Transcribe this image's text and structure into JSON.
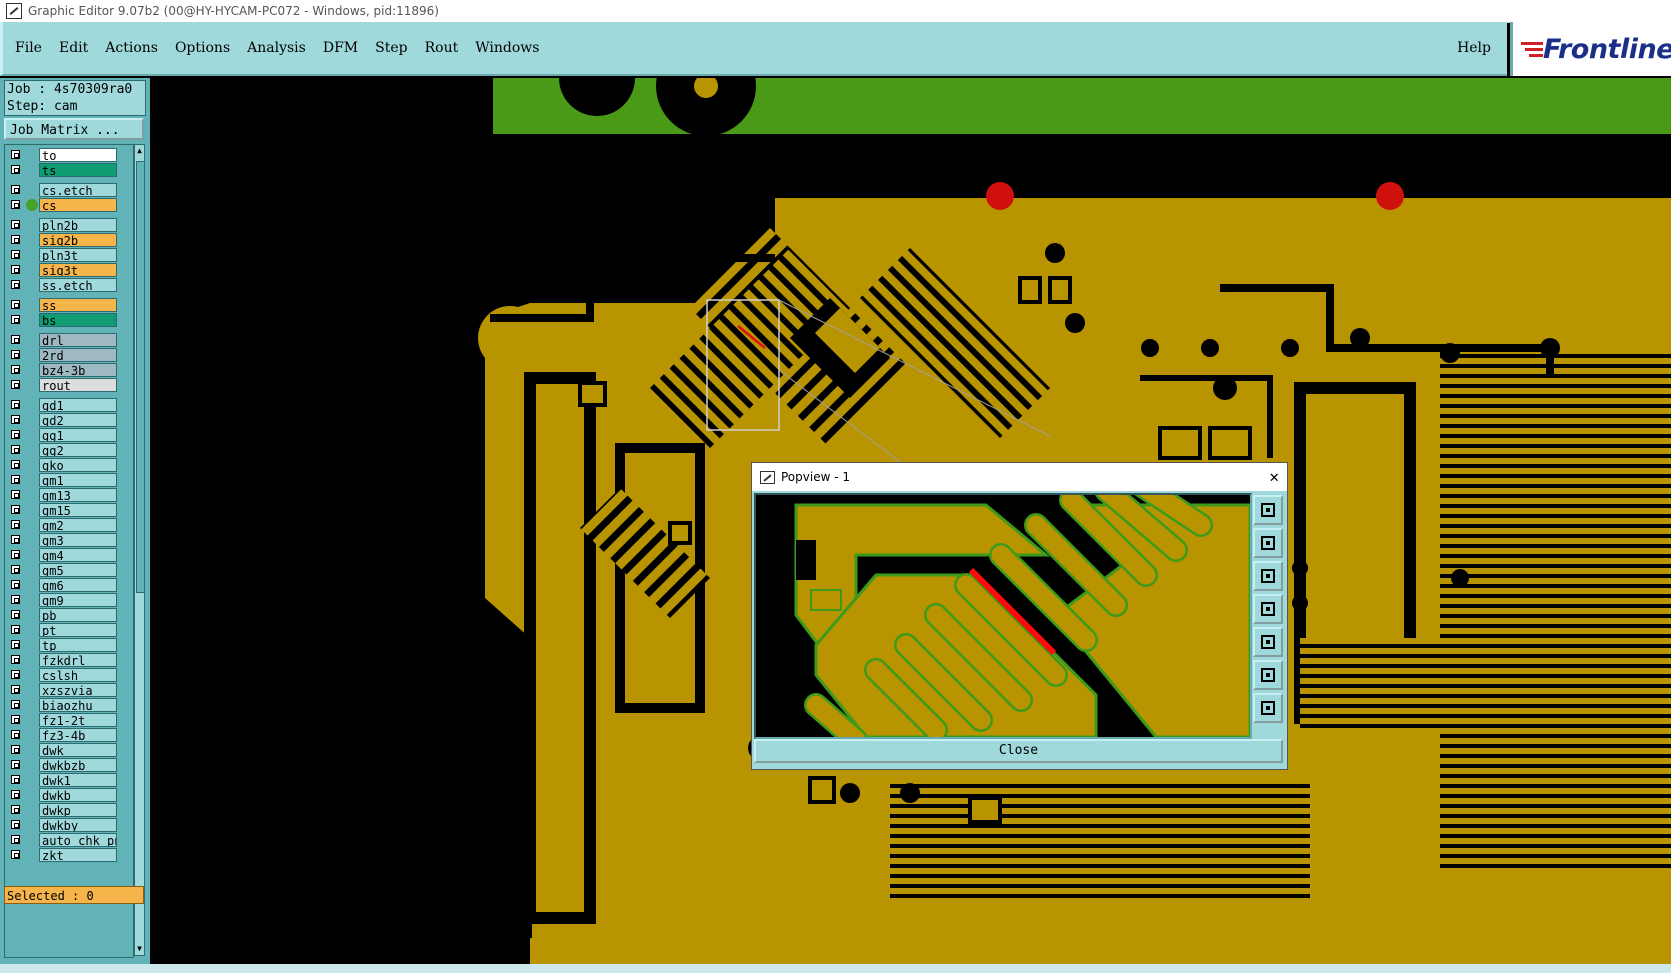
{
  "window": {
    "title": "Graphic Editor 9.07b2 (00@HY-HYCAM-PC072 - Windows, pid:11896)"
  },
  "menu": [
    "File",
    "Edit",
    "Actions",
    "Options",
    "Analysis",
    "DFM",
    "Step",
    "Rout",
    "Windows"
  ],
  "help_label": "Help",
  "logo_text": "Frontline",
  "job": {
    "job_line": "Job : 4s70309ra0",
    "step_line": "Step: cam",
    "job_matrix_label": "Job Matrix ..."
  },
  "layers": [
    {
      "name": "to",
      "color": "#ffffff",
      "active": false
    },
    {
      "name": "ts",
      "color": "#0f9c72",
      "active": false
    },
    {
      "name": "cs.etch",
      "color": "#9fd9dc",
      "active": false
    },
    {
      "name": "cs",
      "color": "#f5b54a",
      "active": true
    },
    {
      "name": "pln2b",
      "color": "#9fd9dc",
      "active": false
    },
    {
      "name": "sig2b",
      "color": "#f5b54a",
      "active": false
    },
    {
      "name": "pln3t",
      "color": "#9fd9dc",
      "active": false
    },
    {
      "name": "sig3t",
      "color": "#f5b54a",
      "active": false
    },
    {
      "name": "ss.etch",
      "color": "#9fd9dc",
      "active": false
    },
    {
      "name": "ss",
      "color": "#f5b54a",
      "active": false
    },
    {
      "name": "bs",
      "color": "#0f9c72",
      "active": false
    },
    {
      "name": "drl",
      "color": "#9fb9c2",
      "active": false
    },
    {
      "name": "2rd",
      "color": "#9fb9c2",
      "active": false
    },
    {
      "name": "bz4-3b",
      "color": "#9fb9c2",
      "active": false
    },
    {
      "name": "rout",
      "color": "#dddddd",
      "active": false
    },
    {
      "name": "gd1",
      "color": "#9fd9dc",
      "active": false
    },
    {
      "name": "gd2",
      "color": "#9fd9dc",
      "active": false
    },
    {
      "name": "gg1",
      "color": "#9fd9dc",
      "active": false
    },
    {
      "name": "gg2",
      "color": "#9fd9dc",
      "active": false
    },
    {
      "name": "gko",
      "color": "#9fd9dc",
      "active": false
    },
    {
      "name": "gm1",
      "color": "#9fd9dc",
      "active": false
    },
    {
      "name": "gm13",
      "color": "#9fd9dc",
      "active": false
    },
    {
      "name": "gm15",
      "color": "#9fd9dc",
      "active": false
    },
    {
      "name": "gm2",
      "color": "#9fd9dc",
      "active": false
    },
    {
      "name": "gm3",
      "color": "#9fd9dc",
      "active": false
    },
    {
      "name": "gm4",
      "color": "#9fd9dc",
      "active": false
    },
    {
      "name": "gm5",
      "color": "#9fd9dc",
      "active": false
    },
    {
      "name": "gm6",
      "color": "#9fd9dc",
      "active": false
    },
    {
      "name": "gm9",
      "color": "#9fd9dc",
      "active": false
    },
    {
      "name": "pb",
      "color": "#9fd9dc",
      "active": false
    },
    {
      "name": "pt",
      "color": "#9fd9dc",
      "active": false
    },
    {
      "name": "tp",
      "color": "#9fd9dc",
      "active": false
    },
    {
      "name": "fzkdrl",
      "color": "#9fd9dc",
      "active": false
    },
    {
      "name": "cslsh",
      "color": "#9fd9dc",
      "active": false
    },
    {
      "name": "xzszvia",
      "color": "#9fd9dc",
      "active": false
    },
    {
      "name": "biaozhu",
      "color": "#9fd9dc",
      "active": false
    },
    {
      "name": "fz1-2t",
      "color": "#9fd9dc",
      "active": false
    },
    {
      "name": "fz3-4b",
      "color": "#9fd9dc",
      "active": false
    },
    {
      "name": "dwk",
      "color": "#9fd9dc",
      "active": false
    },
    {
      "name": "dwkbzb",
      "color": "#9fd9dc",
      "active": false
    },
    {
      "name": "dwk1",
      "color": "#9fd9dc",
      "active": false
    },
    {
      "name": "dwkb",
      "color": "#9fd9dc",
      "active": false
    },
    {
      "name": "dwkp",
      "color": "#9fd9dc",
      "active": false
    },
    {
      "name": "dwkby",
      "color": "#9fd9dc",
      "active": false
    },
    {
      "name": "auto_chk_pn",
      "color": "#9fd9dc",
      "active": false
    },
    {
      "name": "zkt",
      "color": "#9fd9dc",
      "active": false
    }
  ],
  "selected_label": "Selected : 0",
  "popview": {
    "title": "Popview - 1",
    "close_label": "Close",
    "tools": [
      "zoom-fit-icon",
      "pan-up-icon",
      "pan-down-icon",
      "pan-left-icon",
      "pan-right-icon",
      "zoom-in-icon",
      "zoom-out-icon"
    ]
  },
  "colors": {
    "copper": "#b89400",
    "green": "#4a9a18",
    "panel": "#9fd9dc"
  }
}
